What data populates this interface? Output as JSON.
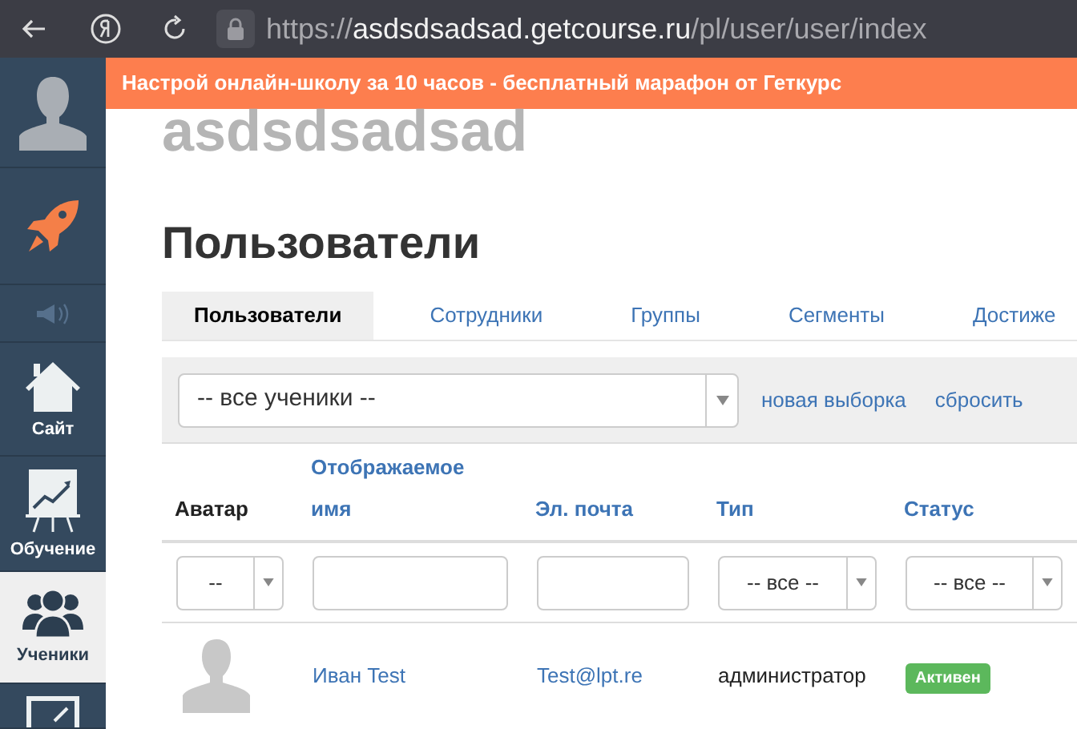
{
  "browser": {
    "url_scheme": "https://",
    "url_host": "asdsdsadsad.getcourse.ru",
    "url_path": "/pl/user/user/index"
  },
  "sidebar": {
    "items": [
      {
        "kind": "avatar",
        "selected": false
      },
      {
        "kind": "rocket",
        "selected": false
      },
      {
        "kind": "speaker",
        "selected": false
      },
      {
        "kind": "house",
        "label": "Сайт",
        "selected": false
      },
      {
        "kind": "chart",
        "label": "Обучение",
        "selected": false
      },
      {
        "kind": "people",
        "label": "Ученики",
        "selected": true
      },
      {
        "kind": "edit",
        "selected": false
      }
    ]
  },
  "banner": "Настрой онлайн-школу за 10 часов - бесплатный марафон от Геткурс",
  "school_title": "asdsdsadsad",
  "page_title": "Пользователи",
  "tabs": [
    {
      "label": "Пользователи",
      "selected": true
    },
    {
      "label": "Сотрудники",
      "selected": false
    },
    {
      "label": "Группы",
      "selected": false
    },
    {
      "label": "Сегменты",
      "selected": false
    },
    {
      "label": "Достиже",
      "selected": false
    }
  ],
  "filter_bar": {
    "select_value": "-- все ученики --",
    "links": [
      "новая выборка",
      "сбросить"
    ]
  },
  "table": {
    "columns": [
      {
        "label": "Аватар",
        "link": false
      },
      {
        "label": "Отображаемое имя",
        "link": true
      },
      {
        "label": "Эл. почта",
        "link": true
      },
      {
        "label": "Тип",
        "link": true
      },
      {
        "label": "Статус",
        "link": true
      }
    ],
    "filters": [
      {
        "kind": "select",
        "value": "--"
      },
      {
        "kind": "input"
      },
      {
        "kind": "input"
      },
      {
        "kind": "select",
        "value": "-- все --"
      },
      {
        "kind": "select",
        "value": "-- все --"
      }
    ],
    "rows": [
      {
        "name": "Иван Test",
        "email": "Test@lpt.re",
        "type": "администратор",
        "status": "Активен"
      }
    ]
  }
}
